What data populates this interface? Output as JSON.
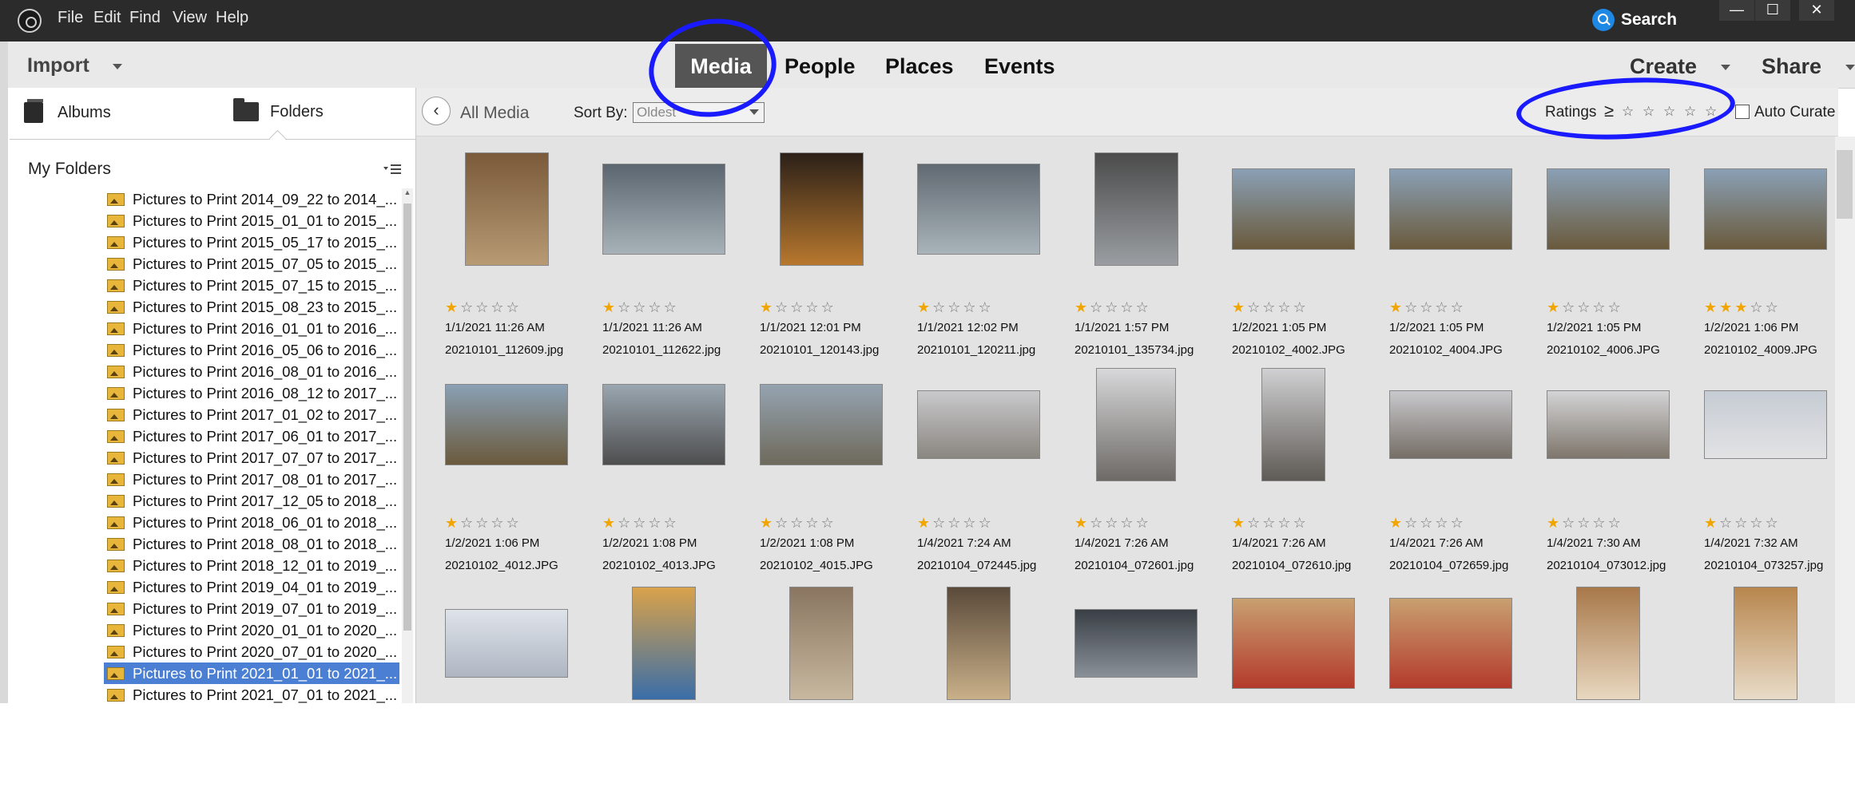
{
  "menubar": {
    "items": [
      "File",
      "Edit",
      "Find",
      "View",
      "Help"
    ],
    "search_label": "Search"
  },
  "window_controls": [
    "—",
    "☐",
    "✕"
  ],
  "topnav": {
    "import_label": "Import",
    "tabs": [
      "Media",
      "People",
      "Places",
      "Events"
    ],
    "active_tab": "Media",
    "create_label": "Create",
    "share_label": "Share"
  },
  "left_panel": {
    "albums_label": "Albums",
    "folders_label": "Folders",
    "section_title": "My Folders",
    "folders": [
      "Pictures to Print 2014_09_22 to 2014_...",
      "Pictures to Print 2015_01_01 to 2015_...",
      "Pictures to Print 2015_05_17 to 2015_...",
      "Pictures to Print 2015_07_05 to 2015_...",
      "Pictures to Print 2015_07_15 to 2015_...",
      "Pictures to Print 2015_08_23 to 2015_...",
      "Pictures to Print 2016_01_01 to 2016_...",
      "Pictures to Print 2016_05_06 to 2016_...",
      "Pictures to Print 2016_08_01 to 2016_...",
      "Pictures to Print 2016_08_12 to 2017_...",
      "Pictures to Print 2017_01_02 to 2017_...",
      "Pictures to Print 2017_06_01 to 2017_...",
      "Pictures to Print 2017_07_07 to 2017_...",
      "Pictures to Print 2017_08_01 to 2017_...",
      "Pictures to Print 2017_12_05 to 2018_...",
      "Pictures to Print 2018_06_01 to 2018_...",
      "Pictures to Print 2018_08_01 to 2018_...",
      "Pictures to Print 2018_12_01 to 2019_...",
      "Pictures to Print 2019_04_01 to 2019_...",
      "Pictures to Print 2019_07_01 to 2019_...",
      "Pictures to Print 2020_01_01 to 2020_...",
      "Pictures to Print 2020_07_01 to 2020_...",
      "Pictures to Print 2021_01_01 to 2021_...",
      "Pictures to Print 2021_07_01 to 2021_..."
    ],
    "selected_index": 22
  },
  "media_header": {
    "back_glyph": "‹",
    "all_media_label": "All Media",
    "sort_by_label": "Sort By:",
    "sort_value": "Oldest",
    "ratings_label": "Ratings",
    "ratings_op": "≥",
    "ratings_min": 0,
    "auto_curate_label": "Auto Curate",
    "auto_curate_checked": false
  },
  "media_items": [
    {
      "date": "1/1/2021 11:26 AM",
      "file": "20210101_112609.jpg",
      "rating": 1,
      "colors": [
        "#7a5a3a",
        "#b89a74"
      ]
    },
    {
      "date": "1/1/2021 11:26 AM",
      "file": "20210101_112622.jpg",
      "rating": 1,
      "colors": [
        "#5b6670",
        "#a7b2b8"
      ]
    },
    {
      "date": "1/1/2021 12:01 PM",
      "file": "20210101_120143.jpg",
      "rating": 1,
      "colors": [
        "#2b2018",
        "#b8782e"
      ]
    },
    {
      "date": "1/1/2021 12:02 PM",
      "file": "20210101_120211.jpg",
      "rating": 1,
      "colors": [
        "#616a72",
        "#a9b3ba"
      ]
    },
    {
      "date": "1/1/2021 1:57 PM",
      "file": "20210101_135734.jpg",
      "rating": 1,
      "colors": [
        "#4b4b4b",
        "#9a9ea2"
      ]
    },
    {
      "date": "1/2/2021 1:05 PM",
      "file": "20210102_4002.JPG",
      "rating": 1,
      "colors": [
        "#8aa0b5",
        "#6a5a3c"
      ]
    },
    {
      "date": "1/2/2021 1:05 PM",
      "file": "20210102_4004.JPG",
      "rating": 1,
      "colors": [
        "#8aa0b5",
        "#6a5a3c"
      ]
    },
    {
      "date": "1/2/2021 1:05 PM",
      "file": "20210102_4006.JPG",
      "rating": 1,
      "colors": [
        "#8aa0b5",
        "#6a5a3c"
      ]
    },
    {
      "date": "1/2/2021 1:06 PM",
      "file": "20210102_4009.JPG",
      "rating": 3,
      "colors": [
        "#8aa0b5",
        "#6a5a3c"
      ]
    },
    {
      "date": "1/2/2021 1:06 PM",
      "file": "20210102_4012.JPG",
      "rating": 1,
      "colors": [
        "#8aa0b5",
        "#6a5a3c"
      ]
    },
    {
      "date": "1/2/2021 1:08 PM",
      "file": "20210102_4013.JPG",
      "rating": 1,
      "colors": [
        "#9aa6b0",
        "#4e4e4e"
      ]
    },
    {
      "date": "1/2/2021 1:08 PM",
      "file": "20210102_4015.JPG",
      "rating": 1,
      "colors": [
        "#95a3b0",
        "#6e6a5c"
      ]
    },
    {
      "date": "1/4/2021 7:24 AM",
      "file": "20210104_072445.jpg",
      "rating": 1,
      "colors": [
        "#c9c9cc",
        "#8a8680"
      ]
    },
    {
      "date": "1/4/2021 7:26 AM",
      "file": "20210104_072601.jpg",
      "rating": 1,
      "colors": [
        "#d8d8da",
        "#6d6a66"
      ]
    },
    {
      "date": "1/4/2021 7:26 AM",
      "file": "20210104_072610.jpg",
      "rating": 1,
      "colors": [
        "#d0d0d2",
        "#5e5a55"
      ]
    },
    {
      "date": "1/4/2021 7:26 AM",
      "file": "20210104_072659.jpg",
      "rating": 1,
      "colors": [
        "#c8c8cc",
        "#766e66"
      ]
    },
    {
      "date": "1/4/2021 7:30 AM",
      "file": "20210104_073012.jpg",
      "rating": 1,
      "colors": [
        "#d4d4d6",
        "#7e766c"
      ]
    },
    {
      "date": "1/4/2021 7:32 AM",
      "file": "20210104_073257.jpg",
      "rating": 1,
      "colors": [
        "#c6ccd4",
        "#e2e2e4"
      ]
    },
    {
      "date": "",
      "file": "",
      "rating": 0,
      "colors": [
        "#dfe3ea",
        "#aeb6c2"
      ]
    },
    {
      "date": "",
      "file": "",
      "rating": 0,
      "colors": [
        "#d9a24a",
        "#3a6ea8"
      ]
    },
    {
      "date": "",
      "file": "",
      "rating": 0,
      "colors": [
        "#8a7660",
        "#c8b8a0"
      ]
    },
    {
      "date": "",
      "file": "",
      "rating": 0,
      "colors": [
        "#5a4a3a",
        "#c9b089"
      ]
    },
    {
      "date": "",
      "file": "",
      "rating": 0,
      "colors": [
        "#3a3f46",
        "#8a9098"
      ]
    },
    {
      "date": "",
      "file": "",
      "rating": 0,
      "colors": [
        "#c8a070",
        "#b43a2c"
      ]
    },
    {
      "date": "",
      "file": "",
      "rating": 0,
      "colors": [
        "#c8a070",
        "#b43a2c"
      ]
    },
    {
      "date": "",
      "file": "",
      "rating": 0,
      "colors": [
        "#a8784a",
        "#e8d8c0"
      ]
    },
    {
      "date": "",
      "file": "",
      "rating": 0,
      "colors": [
        "#b8864e",
        "#e8dcc8"
      ]
    }
  ],
  "annotation_color": "#1a1aff"
}
